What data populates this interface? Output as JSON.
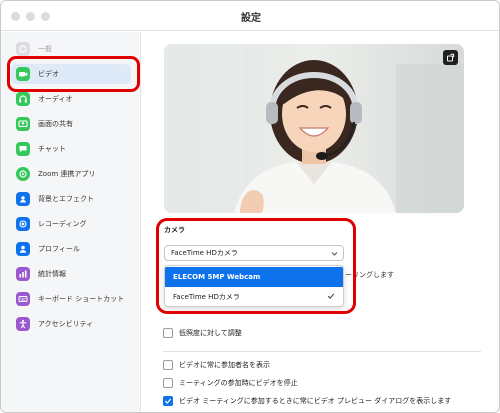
{
  "window": {
    "title": "設定"
  },
  "sidebar": {
    "items": [
      {
        "label": "一般",
        "icon": "gear-icon",
        "color": "#8e8e93"
      },
      {
        "label": "ビデオ",
        "icon": "video-camera-icon",
        "color": "#34c759"
      },
      {
        "label": "オーディオ",
        "icon": "headphones-icon",
        "color": "#34c759"
      },
      {
        "label": "画面の共有",
        "icon": "screen-share-icon",
        "color": "#34c759"
      },
      {
        "label": "チャット",
        "icon": "chat-icon",
        "color": "#34c759"
      },
      {
        "label": "Zoom 連携アプリ",
        "icon": "apps-icon",
        "color": "#34c759"
      },
      {
        "label": "背景とエフェクト",
        "icon": "background-icon",
        "color": "#0e72ed"
      },
      {
        "label": "レコーディング",
        "icon": "record-icon",
        "color": "#0e72ed"
      },
      {
        "label": "プロフィール",
        "icon": "profile-icon",
        "color": "#0e72ed"
      },
      {
        "label": "統計情報",
        "icon": "statistics-icon",
        "color": "#9b59d0"
      },
      {
        "label": "キーボード ショートカット",
        "icon": "keyboard-icon",
        "color": "#9b59d0"
      },
      {
        "label": "アクセシビリティ",
        "icon": "accessibility-icon",
        "color": "#9b59d0"
      }
    ],
    "active_index": 1
  },
  "camera": {
    "label": "カメラ",
    "selected": "FaceTime HDカメラ",
    "options": [
      {
        "label": "ELECOM 5MP Webcam",
        "highlighted": true,
        "checked": false
      },
      {
        "label": "FaceTime HDカメラ",
        "highlighted": false,
        "checked": true
      }
    ],
    "hd_option_partial": "ーリングします"
  },
  "options": [
    {
      "label": "低照度に対して調整",
      "checked": false
    },
    {
      "label": "ビデオに常に参加者名を表示",
      "checked": false
    },
    {
      "label": "ミーティングの参加時にビデオを停止",
      "checked": false
    },
    {
      "label": "ビデオ ミーティングに参加するときに常にビデオ プレビュー ダイアログを表示します",
      "checked": true
    }
  ],
  "colors": {
    "accent": "#0e72ed",
    "highlight": "#e00000"
  }
}
